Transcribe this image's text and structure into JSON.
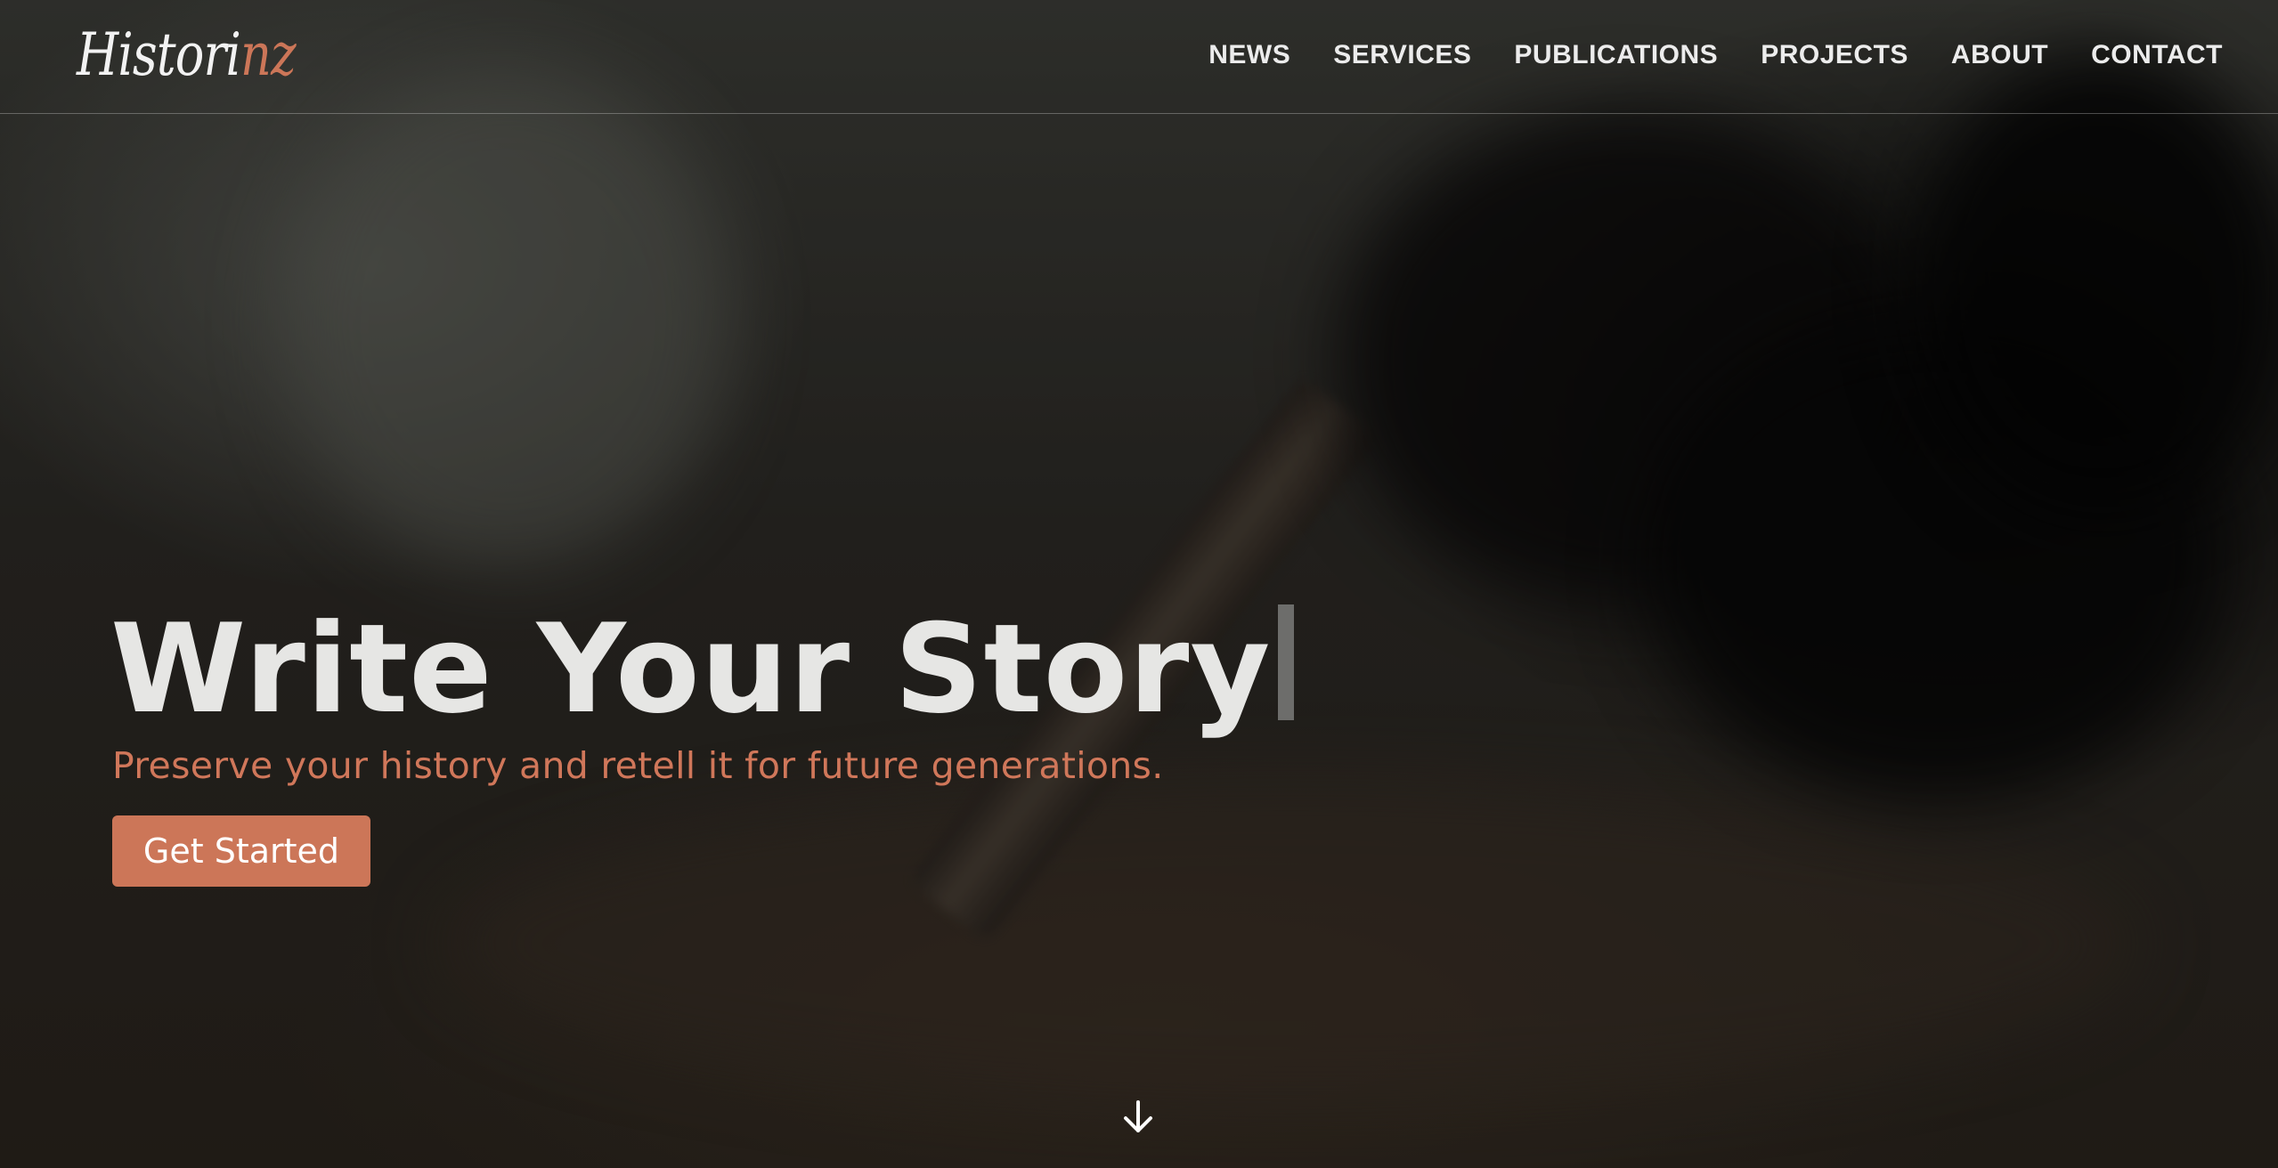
{
  "brand": {
    "logo_main": "Histori",
    "logo_accent": "nz"
  },
  "nav": {
    "items": [
      {
        "label": "NEWS"
      },
      {
        "label": "SERVICES"
      },
      {
        "label": "PUBLICATIONS"
      },
      {
        "label": "PROJECTS"
      },
      {
        "label": "ABOUT"
      },
      {
        "label": "CONTACT"
      }
    ]
  },
  "hero": {
    "headline": "Write Your Story",
    "subheadline": "Preserve your history and retell it for future generations.",
    "cta_label": "Get Started",
    "scroll_icon": "arrow-down-icon"
  },
  "colors": {
    "accent": "#cc7658",
    "headline": "#e6e6e4",
    "nav_text": "#ececec"
  }
}
